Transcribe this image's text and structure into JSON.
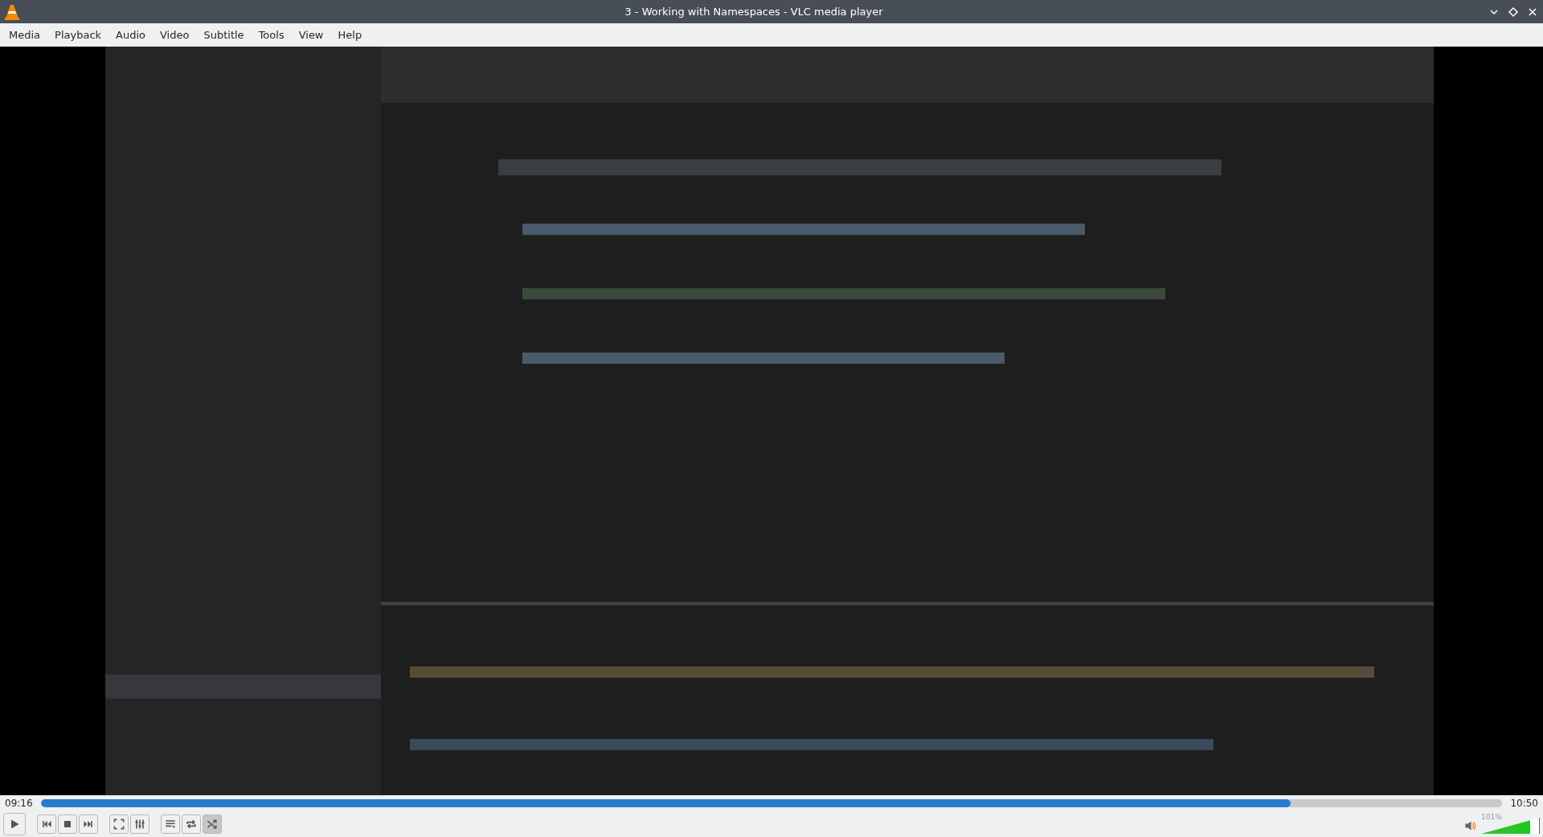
{
  "window": {
    "title": "3 - Working with Namespaces - VLC media player"
  },
  "menu": [
    "Media",
    "Playback",
    "Audio",
    "Video",
    "Subtitle",
    "Tools",
    "View",
    "Help"
  ],
  "seek": {
    "elapsed": "09:16",
    "total": "10:50",
    "level": 0.855
  },
  "controls": {
    "loop": false,
    "random": true
  },
  "volume": {
    "reading": "101%",
    "level": 0.85
  }
}
